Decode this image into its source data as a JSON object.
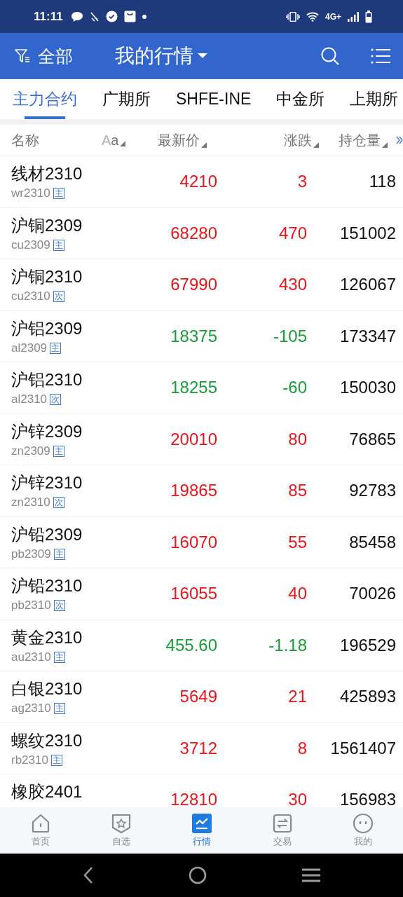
{
  "status_bar": {
    "time": "11:11",
    "network": "4G+"
  },
  "header": {
    "filter_label": "全部",
    "title": "我的行情"
  },
  "tabs": [
    {
      "label": "主力合约",
      "selected": true
    },
    {
      "label": "广期所",
      "selected": false
    },
    {
      "label": "SHFE-INE",
      "selected": false
    },
    {
      "label": "中金所",
      "selected": false
    },
    {
      "label": "上期所",
      "selected": false
    }
  ],
  "table": {
    "columns": [
      "名称",
      "Aa",
      "最新价",
      "涨跌",
      "持仓量"
    ],
    "rows": [
      {
        "name": "线材2310",
        "code": "wr2310",
        "badge": "主",
        "price": "4210",
        "change": "3",
        "open_interest": "118",
        "rising": true
      },
      {
        "name": "沪铜2309",
        "code": "cu2309",
        "badge": "主",
        "price": "68280",
        "change": "470",
        "open_interest": "151002",
        "rising": true
      },
      {
        "name": "沪铜2310",
        "code": "cu2310",
        "badge": "次",
        "price": "67990",
        "change": "430",
        "open_interest": "126067",
        "rising": true
      },
      {
        "name": "沪铝2309",
        "code": "al2309",
        "badge": "主",
        "price": "18375",
        "change": "-105",
        "open_interest": "173347",
        "rising": false
      },
      {
        "name": "沪铝2310",
        "code": "al2310",
        "badge": "次",
        "price": "18255",
        "change": "-60",
        "open_interest": "150030",
        "rising": false
      },
      {
        "name": "沪锌2309",
        "code": "zn2309",
        "badge": "主",
        "price": "20010",
        "change": "80",
        "open_interest": "76865",
        "rising": true
      },
      {
        "name": "沪锌2310",
        "code": "zn2310",
        "badge": "次",
        "price": "19865",
        "change": "85",
        "open_interest": "92783",
        "rising": true
      },
      {
        "name": "沪铅2309",
        "code": "pb2309",
        "badge": "主",
        "price": "16070",
        "change": "55",
        "open_interest": "85458",
        "rising": true
      },
      {
        "name": "沪铅2310",
        "code": "pb2310",
        "badge": "次",
        "price": "16055",
        "change": "40",
        "open_interest": "70026",
        "rising": true
      },
      {
        "name": "黄金2310",
        "code": "au2310",
        "badge": "主",
        "price": "455.60",
        "change": "-1.18",
        "open_interest": "196529",
        "rising": false
      },
      {
        "name": "白银2310",
        "code": "ag2310",
        "badge": "主",
        "price": "5649",
        "change": "21",
        "open_interest": "425893",
        "rising": true
      },
      {
        "name": "螺纹2310",
        "code": "rb2310",
        "badge": "主",
        "price": "3712",
        "change": "8",
        "open_interest": "1561407",
        "rising": true
      },
      {
        "name": "橡胶2401",
        "price": "12810",
        "change": "30",
        "open_interest": "156983",
        "rising": true
      }
    ]
  },
  "bottom_nav": [
    {
      "label": "首页",
      "selected": false
    },
    {
      "label": "自选",
      "selected": false
    },
    {
      "label": "行情",
      "selected": true
    },
    {
      "label": "交易",
      "selected": false
    },
    {
      "label": "我的",
      "selected": false
    }
  ]
}
